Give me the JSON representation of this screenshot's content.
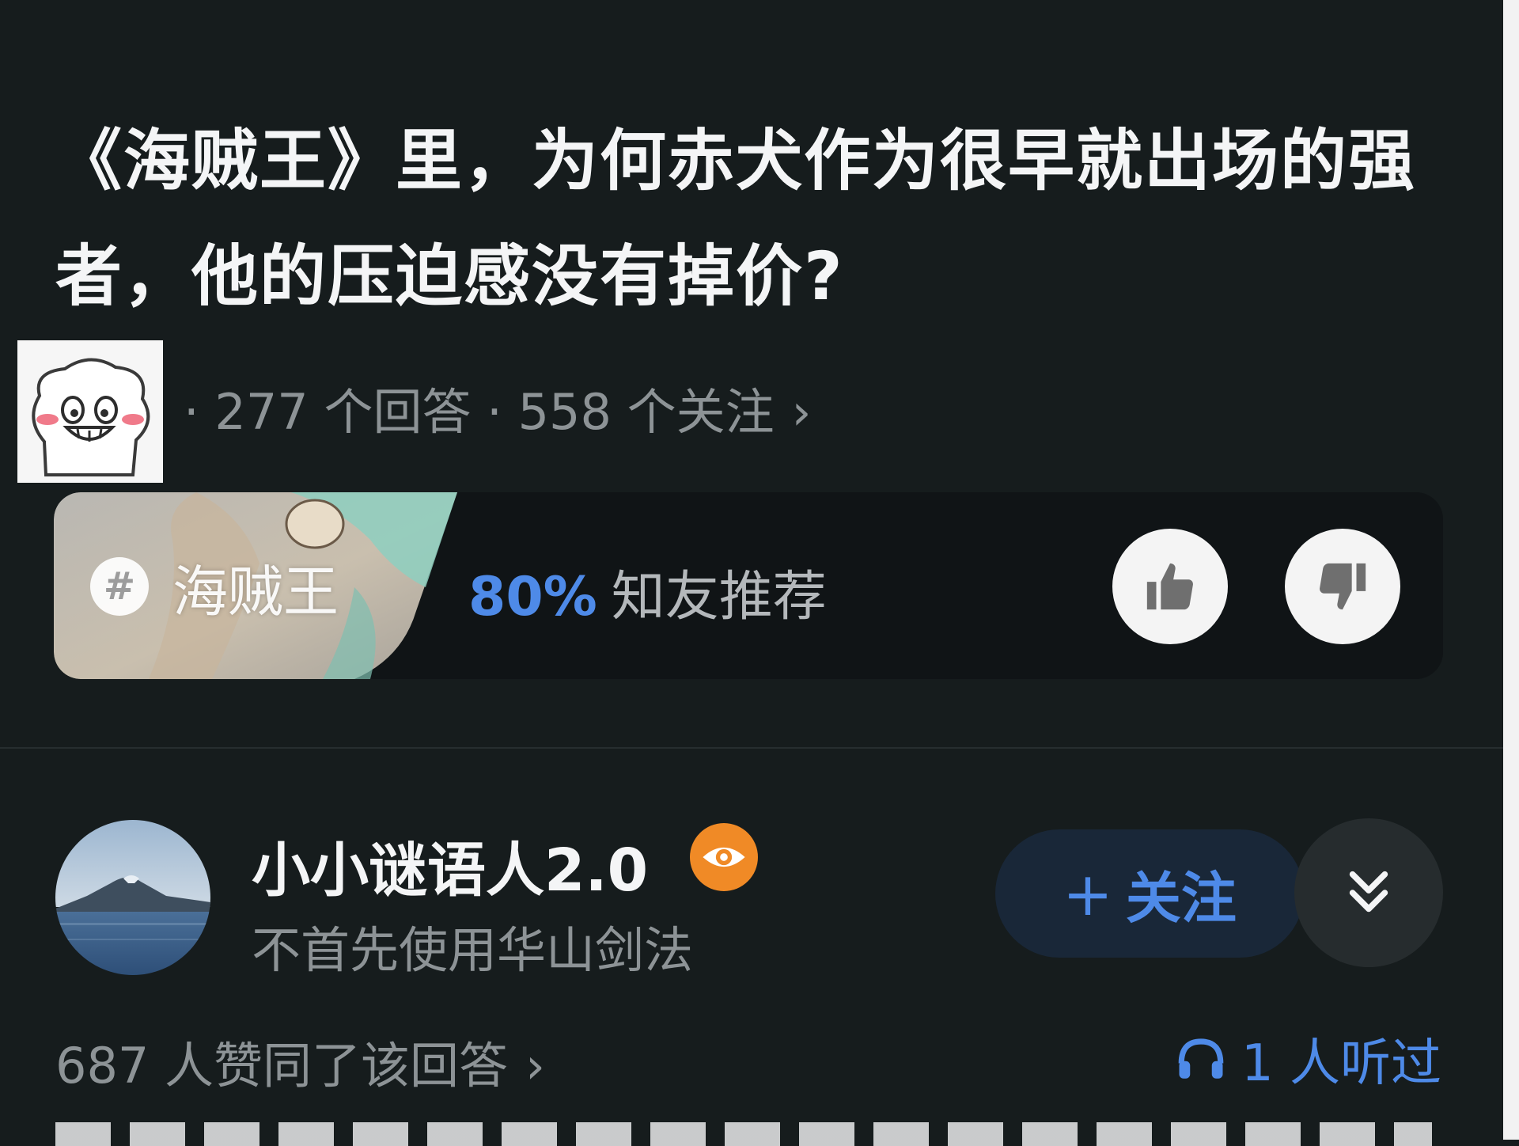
{
  "question": {
    "title": "《海贼王》里，为何赤犬作为很早就出场的强者，他的压迫感没有掉价?",
    "meta": "· 277 个回答 · 558 个关注",
    "meta_chevron": "›"
  },
  "topic": {
    "hash_symbol": "#",
    "name": "海贼王",
    "recommend_percent": "80%",
    "recommend_label": "知友推荐"
  },
  "answer": {
    "author_name": "小小谜语人2.0",
    "author_bio": "不首先使用华山剑法",
    "follow_plus": "+",
    "follow_label": "关注",
    "agree_text": "687 人赞同了该回答",
    "agree_chevron": "›",
    "listen_text": "1 人听过"
  },
  "icons": {
    "upvote": "thumbs-up-icon",
    "downvote": "thumbs-down-icon",
    "expand": "double-chevron-down-icon",
    "listen": "headphones-icon",
    "badge": "eye-icon",
    "topic": "hash-icon"
  },
  "colors": {
    "background": "#161c1d",
    "accent": "#4e8ae8",
    "badge": "#f08a26",
    "muted_text": "#8d9396"
  }
}
